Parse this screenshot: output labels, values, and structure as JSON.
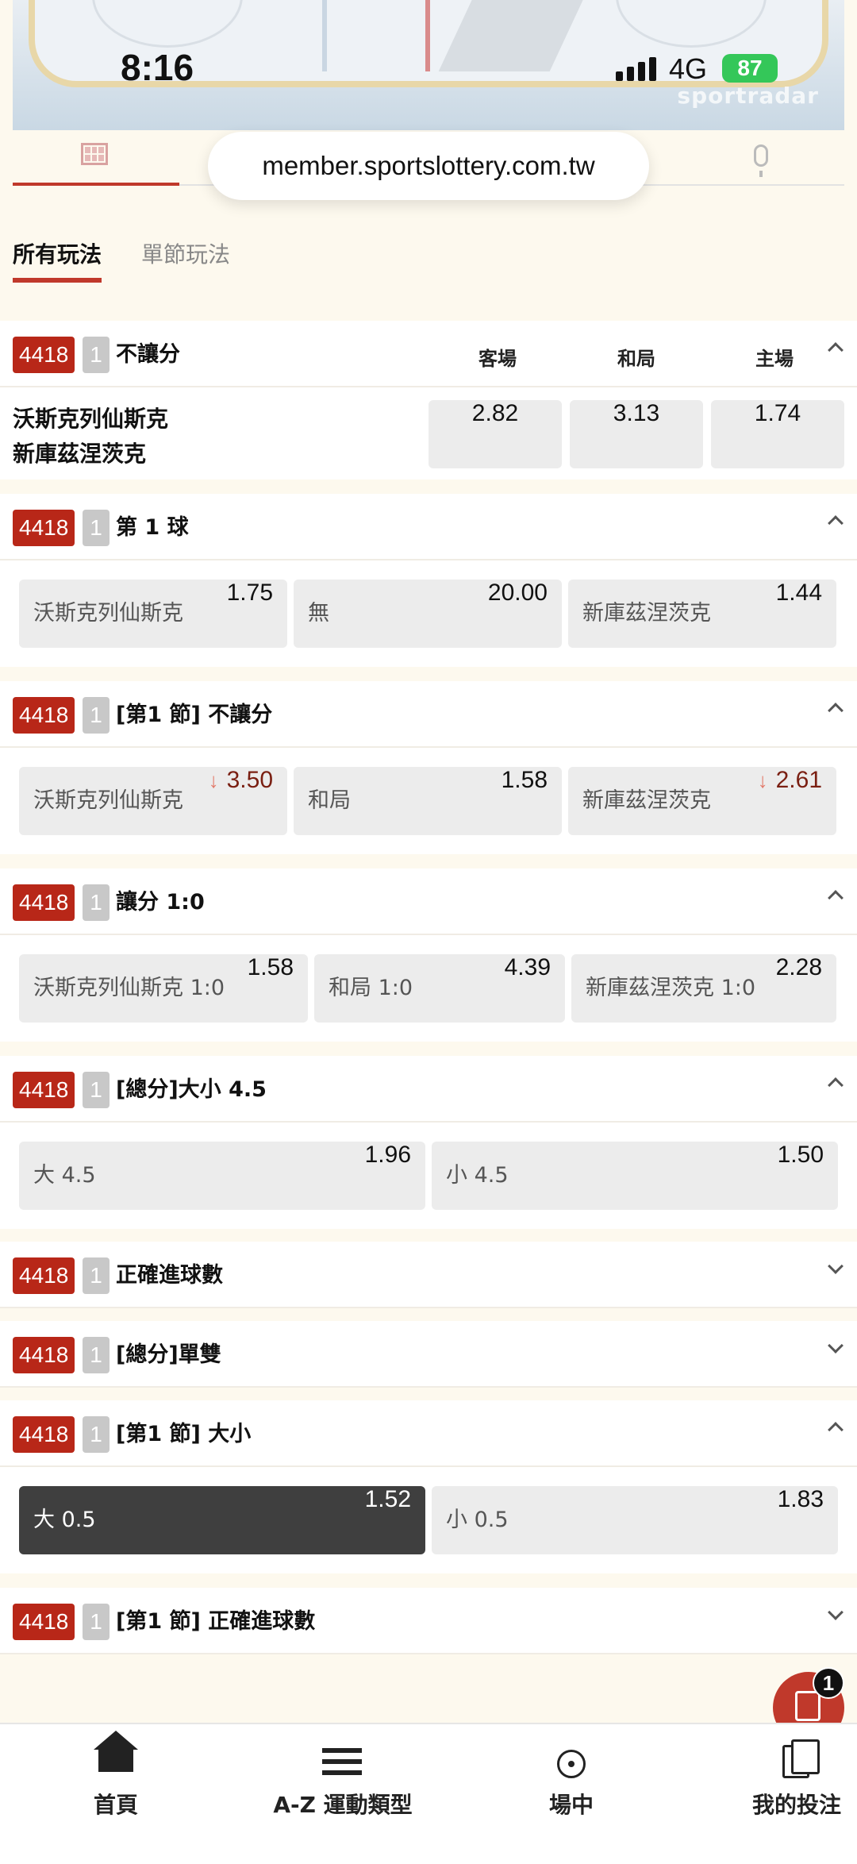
{
  "status": {
    "time": "8:16",
    "network": "4G",
    "battery": "87"
  },
  "video": {
    "brand": "sportradar"
  },
  "browser": {
    "url": "member.sportslottery.com.tw"
  },
  "market_tabs": [
    {
      "label": "所有玩法"
    },
    {
      "label": "單節玩法"
    }
  ],
  "markets": [
    {
      "num": "4418",
      "period": "1",
      "title": "不讓分",
      "cols": [
        "客場",
        "和局",
        "主場"
      ],
      "teams": [
        "沃斯克列仙斯克",
        "新庫茲涅茨克"
      ],
      "odds": [
        "2.82",
        "3.13",
        "1.74"
      ]
    },
    {
      "num": "4418",
      "period": "1",
      "title": "第 1 球",
      "options": [
        {
          "label": "沃斯克列仙斯克",
          "odd": "1.75"
        },
        {
          "label": "無",
          "odd": "20.00"
        },
        {
          "label": "新庫茲涅茨克",
          "odd": "1.44"
        }
      ]
    },
    {
      "num": "4418",
      "period": "1",
      "title": "[第1 節] 不讓分",
      "options": [
        {
          "label": "沃斯克列仙斯克",
          "odd": "3.50",
          "trend": "↓"
        },
        {
          "label": "和局",
          "odd": "1.58"
        },
        {
          "label": "新庫茲涅茨克",
          "odd": "2.61",
          "trend": "↓"
        }
      ]
    },
    {
      "num": "4418",
      "period": "1",
      "title": "讓分 1:0",
      "options": [
        {
          "label": "沃斯克列仙斯克 1:0",
          "odd": "1.58"
        },
        {
          "label": "和局 1:0",
          "odd": "4.39"
        },
        {
          "label": "新庫茲涅茨克 1:0",
          "odd": "2.28"
        }
      ]
    },
    {
      "num": "4418",
      "period": "1",
      "title": "[總分]大小 4.5",
      "options": [
        {
          "label": "大 4.5",
          "odd": "1.96"
        },
        {
          "label": "小 4.5",
          "odd": "1.50"
        }
      ]
    },
    {
      "num": "4418",
      "period": "1",
      "title": "正確進球數"
    },
    {
      "num": "4418",
      "period": "1",
      "title": "[總分]單雙"
    },
    {
      "num": "4418",
      "period": "1",
      "title": "[第1 節] 大小",
      "options": [
        {
          "label": "大 0.5",
          "odd": "1.52"
        },
        {
          "label": "小 0.5",
          "odd": "1.83"
        }
      ]
    },
    {
      "num": "4418",
      "period": "1",
      "title": "[第1 節] 正確進球數"
    }
  ],
  "betslip": {
    "count": "1"
  },
  "bottom_nav": [
    {
      "label": "首頁"
    },
    {
      "label": "A-Z 運動類型"
    },
    {
      "label": "場中"
    },
    {
      "label": "我的投注"
    }
  ],
  "colors": {
    "accent": "#b82718",
    "selected": "#3f3f3f",
    "trend_down": "#e27a6a"
  }
}
